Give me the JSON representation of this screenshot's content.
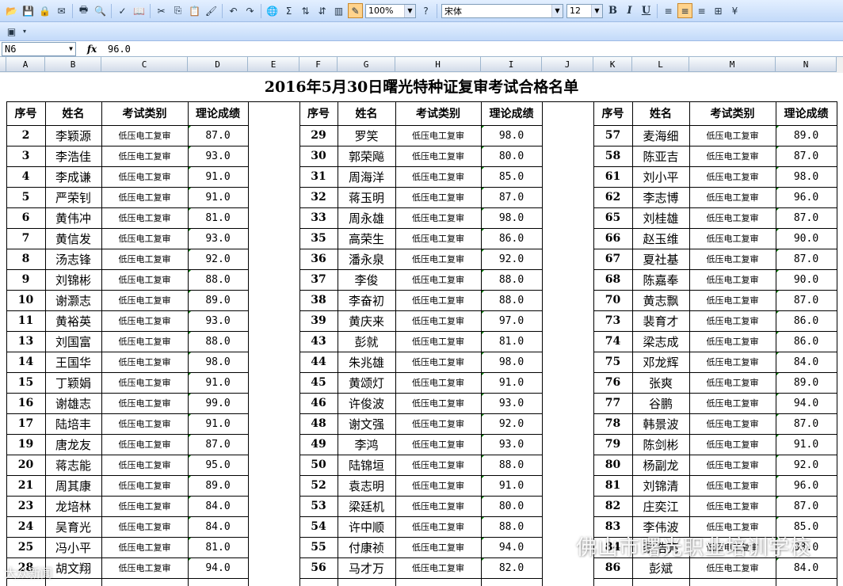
{
  "toolbar": {
    "zoom": "100%",
    "font_name": "宋体",
    "font_size": "12",
    "bold_label": "B",
    "italic_label": "I",
    "underline_label": "U"
  },
  "formula_bar": {
    "name_box": "N6",
    "fx_label": "fx",
    "value": "96.0"
  },
  "columns": [
    "A",
    "B",
    "C",
    "D",
    "E",
    "F",
    "G",
    "H",
    "I",
    "J",
    "K",
    "L",
    "M",
    "N"
  ],
  "sheet": {
    "title": "2016年5月30日曙光特种证复审考试合格名单",
    "headers": [
      "序号",
      "姓名",
      "考试类别",
      "理论成绩"
    ],
    "blocks": [
      {
        "rows": [
          [
            "2",
            "李颖源",
            "低压电工复审",
            "87.0"
          ],
          [
            "3",
            "李浩佳",
            "低压电工复审",
            "93.0"
          ],
          [
            "4",
            "李成谦",
            "低压电工复审",
            "91.0"
          ],
          [
            "5",
            "严荣钊",
            "低压电工复审",
            "91.0"
          ],
          [
            "6",
            "黄伟冲",
            "低压电工复审",
            "81.0"
          ],
          [
            "7",
            "黄信发",
            "低压电工复审",
            "93.0"
          ],
          [
            "8",
            "汤志锋",
            "低压电工复审",
            "92.0"
          ],
          [
            "9",
            "刘锦彬",
            "低压电工复审",
            "88.0"
          ],
          [
            "10",
            "谢灏志",
            "低压电工复审",
            "89.0"
          ],
          [
            "11",
            "黄裕英",
            "低压电工复审",
            "93.0"
          ],
          [
            "13",
            "刘国富",
            "低压电工复审",
            "88.0"
          ],
          [
            "14",
            "王国华",
            "低压电工复审",
            "98.0"
          ],
          [
            "15",
            "丁颖娟",
            "低压电工复审",
            "91.0"
          ],
          [
            "16",
            "谢雄志",
            "低压电工复审",
            "99.0"
          ],
          [
            "17",
            "陆培丰",
            "低压电工复审",
            "91.0"
          ],
          [
            "19",
            "唐龙友",
            "低压电工复审",
            "87.0"
          ],
          [
            "20",
            "蒋志能",
            "低压电工复审",
            "95.0"
          ],
          [
            "21",
            "周其康",
            "低压电工复审",
            "89.0"
          ],
          [
            "23",
            "龙培林",
            "低压电工复审",
            "84.0"
          ],
          [
            "24",
            "吴育光",
            "低压电工复审",
            "84.0"
          ],
          [
            "25",
            "冯小平",
            "低压电工复审",
            "81.0"
          ],
          [
            "28",
            "胡文翔",
            "低压电工复审",
            "94.0"
          ]
        ]
      },
      {
        "rows": [
          [
            "29",
            "罗笑",
            "低压电工复审",
            "98.0"
          ],
          [
            "30",
            "郭荣飚",
            "低压电工复审",
            "80.0"
          ],
          [
            "31",
            "周海洋",
            "低压电工复审",
            "85.0"
          ],
          [
            "32",
            "蒋玉明",
            "低压电工复审",
            "87.0"
          ],
          [
            "33",
            "周永雄",
            "低压电工复审",
            "98.0"
          ],
          [
            "35",
            "高荣生",
            "低压电工复审",
            "86.0"
          ],
          [
            "36",
            "潘永泉",
            "低压电工复审",
            "92.0"
          ],
          [
            "37",
            "李俊",
            "低压电工复审",
            "88.0"
          ],
          [
            "38",
            "李奋初",
            "低压电工复审",
            "88.0"
          ],
          [
            "39",
            "黄庆来",
            "低压电工复审",
            "97.0"
          ],
          [
            "43",
            "彭就",
            "低压电工复审",
            "81.0"
          ],
          [
            "44",
            "朱兆雄",
            "低压电工复审",
            "98.0"
          ],
          [
            "45",
            "黄颂灯",
            "低压电工复审",
            "91.0"
          ],
          [
            "46",
            "许俊波",
            "低压电工复审",
            "93.0"
          ],
          [
            "48",
            "谢文强",
            "低压电工复审",
            "92.0"
          ],
          [
            "49",
            "李鸿",
            "低压电工复审",
            "93.0"
          ],
          [
            "50",
            "陆锦垣",
            "低压电工复审",
            "88.0"
          ],
          [
            "52",
            "袁志明",
            "低压电工复审",
            "91.0"
          ],
          [
            "53",
            "梁廷机",
            "低压电工复审",
            "80.0"
          ],
          [
            "54",
            "许中顺",
            "低压电工复审",
            "88.0"
          ],
          [
            "55",
            "付康祯",
            "低压电工复审",
            "94.0"
          ],
          [
            "56",
            "马才万",
            "低压电工复审",
            "82.0"
          ]
        ]
      },
      {
        "rows": [
          [
            "57",
            "麦海细",
            "低压电工复审",
            "89.0"
          ],
          [
            "58",
            "陈亚吉",
            "低压电工复审",
            "87.0"
          ],
          [
            "61",
            "刘小平",
            "低压电工复审",
            "98.0"
          ],
          [
            "62",
            "李志博",
            "低压电工复审",
            "96.0"
          ],
          [
            "65",
            "刘桂雄",
            "低压电工复审",
            "87.0"
          ],
          [
            "66",
            "赵玉维",
            "低压电工复审",
            "90.0"
          ],
          [
            "67",
            "夏社基",
            "低压电工复审",
            "87.0"
          ],
          [
            "68",
            "陈嘉奉",
            "低压电工复审",
            "90.0"
          ],
          [
            "70",
            "黄志飘",
            "低压电工复审",
            "87.0"
          ],
          [
            "73",
            "裴育才",
            "低压电工复审",
            "86.0"
          ],
          [
            "74",
            "梁志成",
            "低压电工复审",
            "86.0"
          ],
          [
            "75",
            "邓龙辉",
            "低压电工复审",
            "84.0"
          ],
          [
            "76",
            "张爽",
            "低压电工复审",
            "89.0"
          ],
          [
            "77",
            "谷鹏",
            "低压电工复审",
            "94.0"
          ],
          [
            "78",
            "韩景波",
            "低压电工复审",
            "87.0"
          ],
          [
            "79",
            "陈剑彬",
            "低压电工复审",
            "91.0"
          ],
          [
            "80",
            "杨副龙",
            "低压电工复审",
            "92.0"
          ],
          [
            "81",
            "刘锦清",
            "低压电工复审",
            "96.0"
          ],
          [
            "82",
            "庄奕江",
            "低压电工复审",
            "87.0"
          ],
          [
            "83",
            "李伟波",
            "低压电工复审",
            "85.0"
          ],
          [
            "84",
            "黎浩亮",
            "低压电工复审",
            "93.0"
          ],
          [
            "86",
            "彭斌",
            "低压电工复审",
            "84.0"
          ]
        ]
      }
    ]
  },
  "watermark": {
    "main": "佛山市曙光职业培训学校",
    "corner": "大众新闻"
  }
}
